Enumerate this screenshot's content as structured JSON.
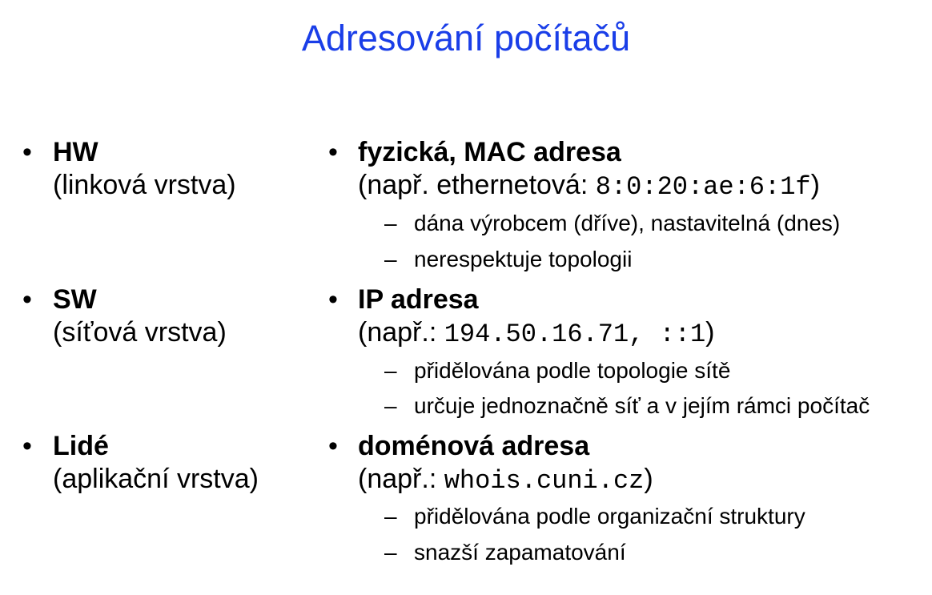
{
  "title": "Adresování počítačů",
  "left": [
    {
      "name": "HW",
      "layer": "(linková vrstva)"
    },
    {
      "name": "SW",
      "layer": "(síťová vrstva)"
    },
    {
      "name": "Lidé",
      "layer": "(aplikační vrstva)"
    }
  ],
  "right": [
    {
      "heading": "fyzická, MAC adresa",
      "example_prefix": "(např. ethernetová: ",
      "example_code": "8:0:20:ae:6:1f",
      "example_suffix": ")",
      "points": [
        "dána výrobcem (dříve), nastavitelná (dnes)",
        "nerespektuje topologii"
      ]
    },
    {
      "heading": "IP adresa",
      "example_prefix": "(např.: ",
      "example_code": "194.50.16.71, ::1",
      "example_suffix": ")",
      "points": [
        "přidělována podle topologie sítě",
        "určuje jednoznačně síť a v jejím rámci počítač"
      ]
    },
    {
      "heading": "doménová adresa",
      "example_prefix": "(např.: ",
      "example_code": "whois.cuni.cz",
      "example_suffix": ")",
      "points": [
        "přidělována podle organizační struktury",
        "snazší zapamatování"
      ]
    }
  ],
  "symbols": {
    "bullet": "•",
    "dash": "–"
  }
}
